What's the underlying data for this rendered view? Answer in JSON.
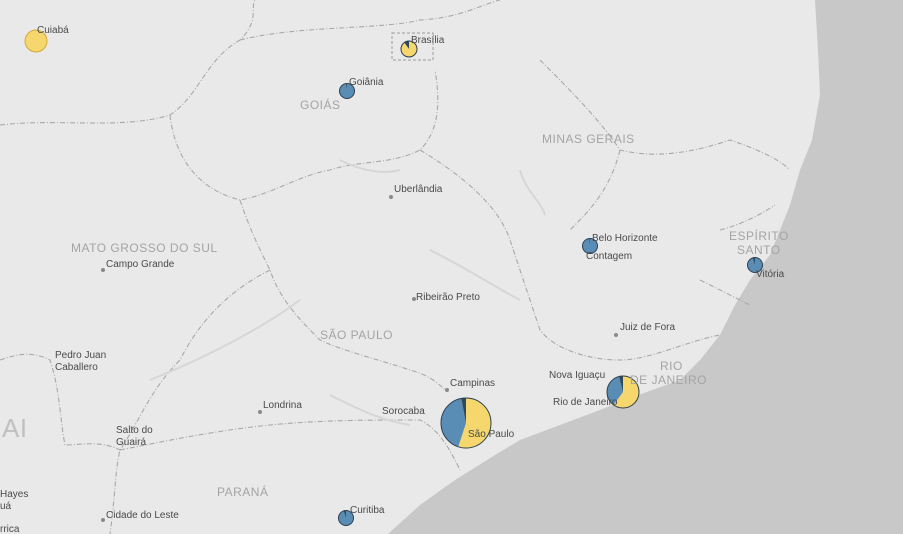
{
  "colors": {
    "land": "#e9e9e9",
    "ocean": "#c8c8c8",
    "border": "#a9a9a9",
    "series_a": "#f5d76e",
    "series_b": "#5a8db5",
    "series_c": "#2e4a5a",
    "pie_outline": "#2c3e50"
  },
  "states": {
    "goias": "GOIÁS",
    "minas_gerais": "MINAS GERAIS",
    "mato_grosso_do_sul": "MATO GROSSO DO SUL",
    "espirito_santo_1": "ESPÍRITO",
    "espirito_santo_2": "SANTO",
    "sao_paulo": "SÃO PAULO",
    "rio_de_janeiro_1": "RIO",
    "rio_de_janeiro_2": "DE JANEIRO",
    "parana": "PARANÁ",
    "partial_left": "AI"
  },
  "cities": {
    "cuiaba": "Cuiabá",
    "brasilia": "Brasília",
    "goiania": "Goiânia",
    "uberlandia": "Uberlândia",
    "belo_horizonte": "Belo Horizonte",
    "contagem": "Contagem",
    "vitoria": "Vitória",
    "campo_grande": "Campo Grande",
    "ribeirao_preto": "Ribeirão Preto",
    "juiz_de_fora": "Juiz de Fora",
    "pedro_juan_1": "Pedro Juan",
    "pedro_juan_2": "Caballero",
    "campinas": "Campinas",
    "nova_iguacu": "Nova Iguaçu",
    "rio_de_janeiro": "Rio de Janeiro",
    "sorocaba": "Sorocaba",
    "sao_paulo": "São Paulo",
    "londrina": "Londrina",
    "salto_1": "Salto do",
    "salto_2": "Guairá",
    "hayes_1": "Hayes",
    "hayes_2": "uá",
    "rrica": "rrica",
    "cidade_do_leste": "Cidade do Leste",
    "curitiba": "Curitiba"
  },
  "pies": [
    {
      "city": "Cuiabá",
      "slices": [
        1.0,
        0.0,
        0.0
      ]
    },
    {
      "city": "Brasília",
      "slices": [
        0.9,
        0.0,
        0.1
      ]
    },
    {
      "city": "Goiânia",
      "slices": [
        0.0,
        0.98,
        0.02
      ]
    },
    {
      "city": "Belo Horizonte",
      "slices": [
        0.0,
        0.98,
        0.02
      ]
    },
    {
      "city": "Vitória",
      "slices": [
        0.0,
        0.95,
        0.05
      ]
    },
    {
      "city": "São Paulo",
      "slices": [
        0.55,
        0.42,
        0.03
      ]
    },
    {
      "city": "Rio de Janeiro",
      "slices": [
        0.6,
        0.36,
        0.04
      ]
    },
    {
      "city": "Curitiba",
      "slices": [
        0.0,
        0.95,
        0.05
      ]
    }
  ]
}
